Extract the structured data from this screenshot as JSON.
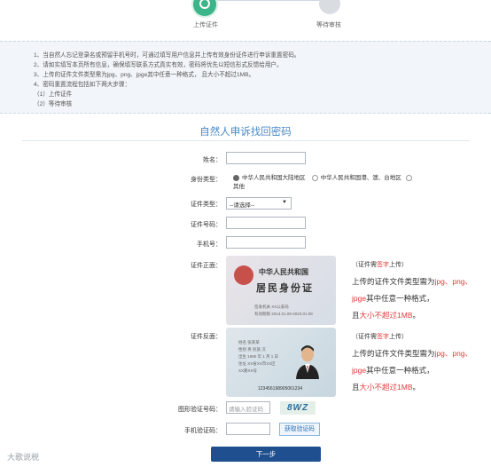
{
  "steps": [
    {
      "label": "上传证件"
    },
    {
      "label": "等待审核"
    }
  ],
  "notes": [
    "1、当自然人忘记登录名或预留手机号时，可通过填写用户信息并上传有效身份证件进行申诉重置密码。",
    "2、请如实填写本页所有信息，确保填写联系方式真实有效，密码将优先以短信形式反馈给用户。",
    "3、上传的证件文件类型需为jpg、png、jpge其中任意一种格式，  且大小不超过1MB。",
    "4、密码重置流程包括如下两大步骤：",
    "（1）上传证件",
    "（2）等待审核"
  ],
  "title": "自然人申诉找回密码",
  "form": {
    "name_label": "姓名：",
    "identity_label": "身份类型：",
    "identity_options": [
      "中华人民共和国大陆地区",
      "中华人民共和国港、澳、台地区",
      "其他"
    ],
    "cert_type_label": "证件类型：",
    "cert_type_value": "--请选择--",
    "cert_no_label": "证件号码：",
    "phone_label": "手机号：",
    "front_label": "证件正面：",
    "back_label": "证件反面：",
    "captcha_label": "图形验证号码：",
    "captcha_placeholder": "请输入验证码",
    "captcha_text": "8WZ",
    "sms_label": "手机验证码：",
    "sms_button": "获取验证码",
    "submit": "下一步"
  },
  "card_front": {
    "line1": "中华人民共和国",
    "line2": "居民身份证",
    "small1": "签发机关  XX公安局",
    "small2": "有效期限  2013.01.09-2023.01.09"
  },
  "card_back": {
    "name": "姓名 张某某",
    "gender": "性别 男  民族 汉",
    "birth": "出生 1990 年 1 月 1 日",
    "addr": "住址 XX省XX市XX区",
    "addr2": "XX路XX号",
    "id": "123456198905061234"
  },
  "hint": {
    "p1_pre": "（证件需",
    "p1_red": "签字",
    "p1_post": "上传）",
    "p2_pre": "上传的证件文件类型需为",
    "p2_red": "jpg、png、jpge",
    "p2_post": "其中任意一种格式，",
    "p3_pre": "且",
    "p3_red": "大小不超过1MB",
    "p3_post": "。"
  },
  "watermark": "大歌说税",
  "colors": {
    "accent": "#3ab68a",
    "title": "#4a8ac9",
    "button": "#1f4f8f",
    "warn": "#e23b3b"
  }
}
